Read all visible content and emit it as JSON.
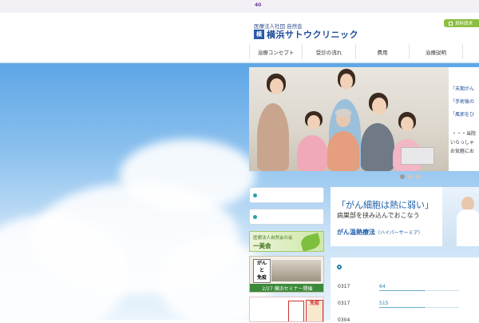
{
  "topbar": {
    "count": "40"
  },
  "header": {
    "org_name": "医療法人社団 自然会",
    "logo_mark": "横",
    "clinic_name": "横浜サトウクリニック",
    "doc_button": "資料請求"
  },
  "nav": [
    {
      "label": "治療コンセプト"
    },
    {
      "label": "受診の流れ"
    },
    {
      "label": "費用"
    },
    {
      "label": "治療説明"
    }
  ],
  "hero": {
    "lines": [
      "「末期がん",
      "「手術後の",
      "「風邪をひ",
      "・・・当院",
      "いらっしゃ",
      "お気軽にお"
    ]
  },
  "banners": {
    "ichiikai_small": "医療法人自然会の会",
    "ichiikai_big": "一美会",
    "seminar_board": "がん\nと\n免疫",
    "seminar_strip": "2/27 横浜セミナー開催",
    "book_text": "免疫"
  },
  "heat": {
    "line1": "「がん細胞は熱に弱い」",
    "line2": "病巣部を挟み込んでおこなう",
    "line3": "がん温熱療法",
    "line3_sub": "（ハイパーサーミア）"
  },
  "news": [
    {
      "date": "0317",
      "link": "64"
    },
    {
      "date": "0317",
      "link": "515"
    },
    {
      "date": "0304",
      "link": ""
    }
  ]
}
